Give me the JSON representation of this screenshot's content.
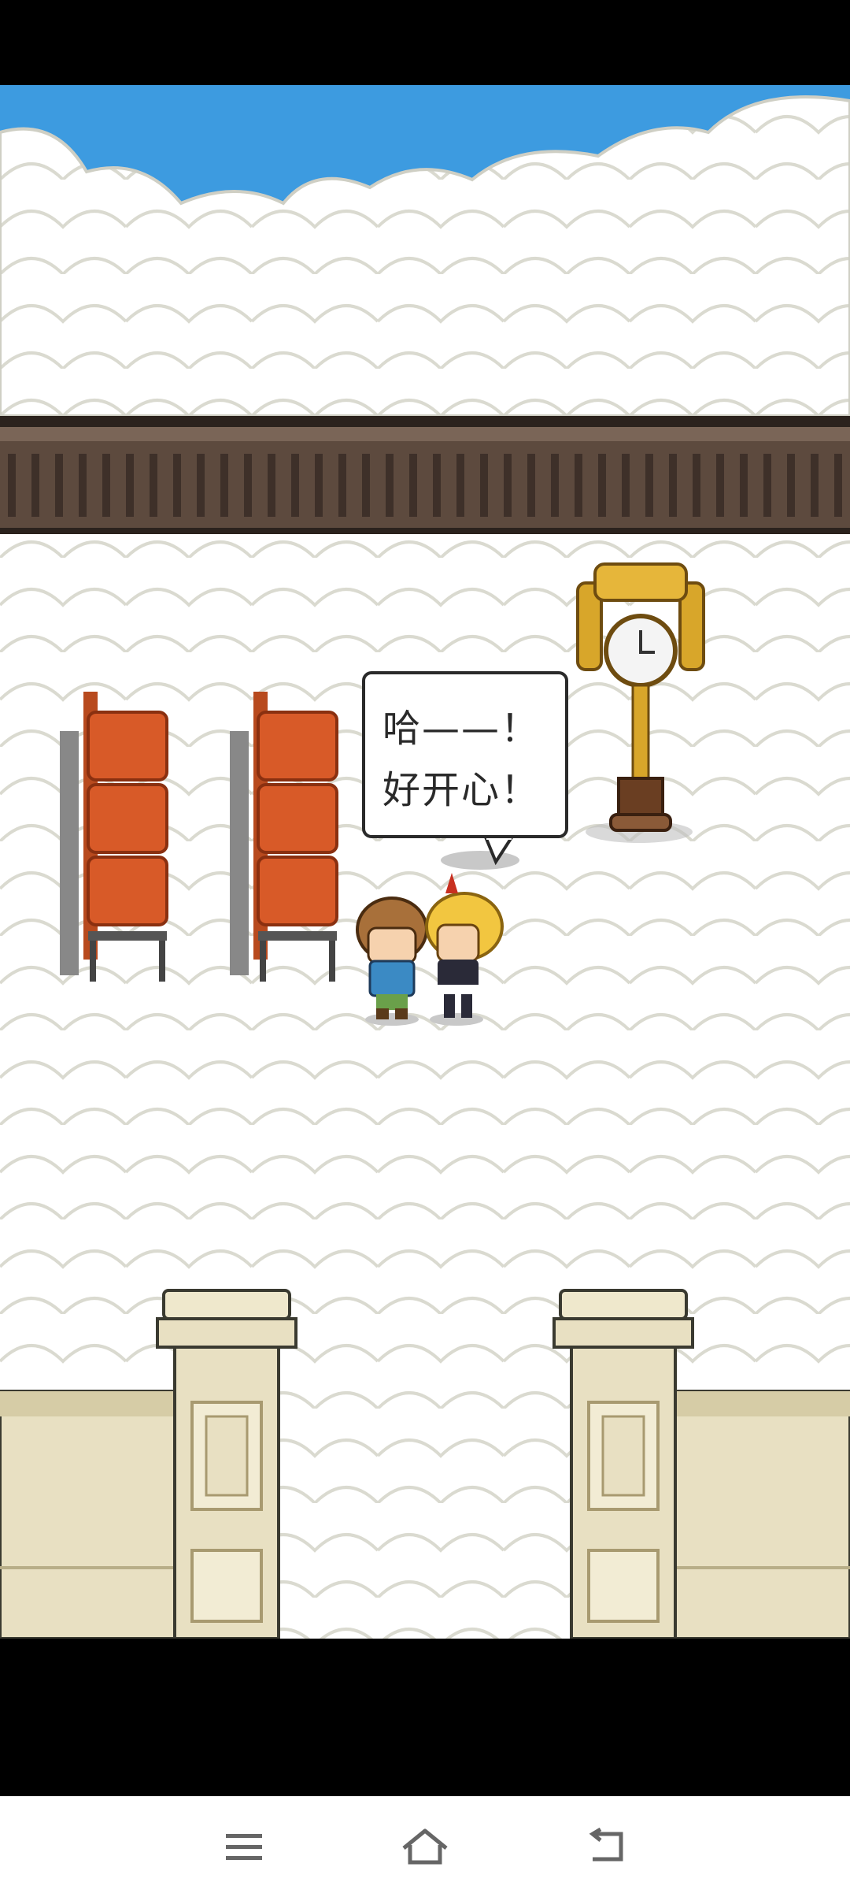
{
  "dialogue": {
    "lines": [
      "哈——！",
      "好开心！"
    ]
  },
  "scene": {
    "setting": "cloud-platform",
    "characters": [
      "brown-haired-kid",
      "blonde-girl-with-horn"
    ]
  },
  "navigation": {
    "menu_icon": "menu-icon",
    "home_icon": "home-icon",
    "back_icon": "back-icon"
  },
  "colors": {
    "sky": "#3d9be0",
    "cloud_outline": "#d9d9cf",
    "railing": "#5d4a3e",
    "seat": "#d85a28",
    "pillar": "#e8e0c2",
    "clock_gold": "#d8a62a"
  }
}
